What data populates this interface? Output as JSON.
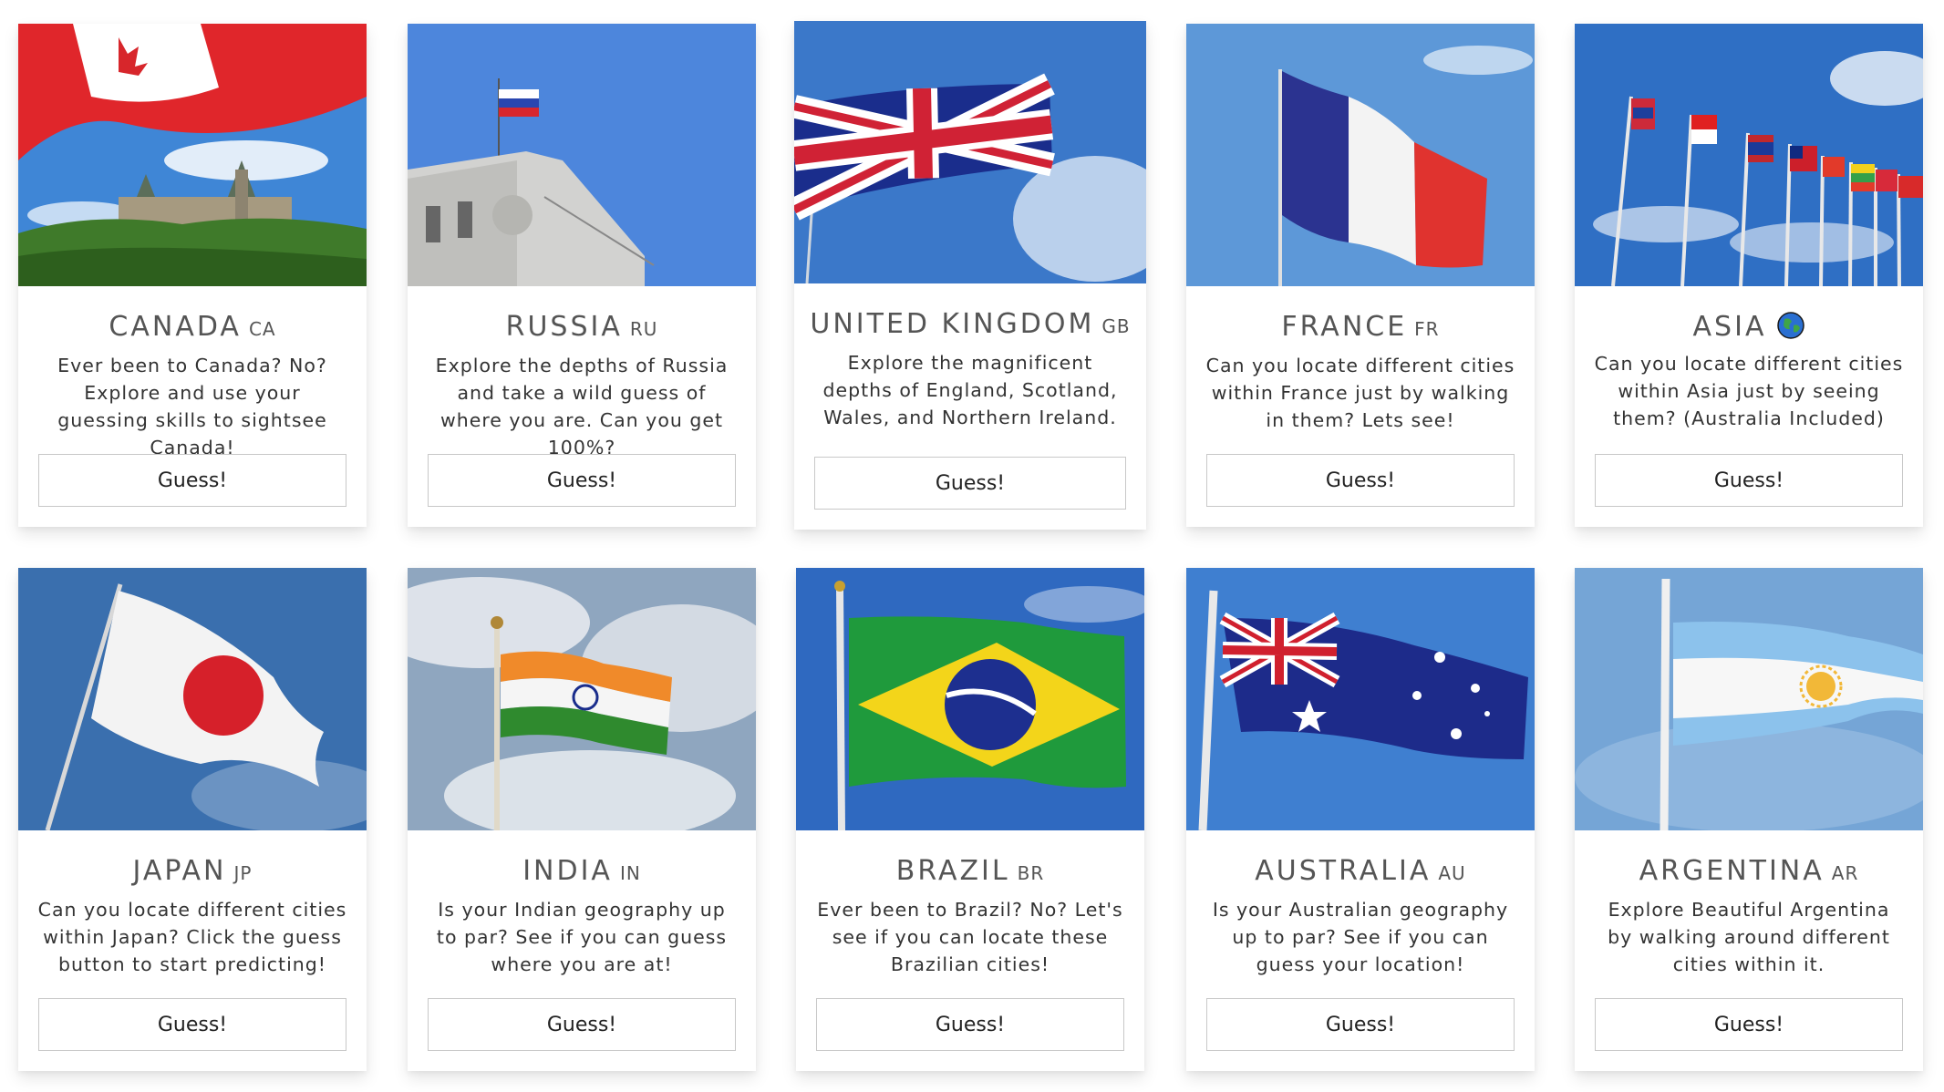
{
  "cards": [
    {
      "name": "CANADA",
      "code": "CA",
      "desc": "Ever been to Canada? No? Explore and use your guessing skills to sightsee Canada!",
      "button": "Guess!"
    },
    {
      "name": "RUSSIA",
      "code": "RU",
      "desc": "Explore the depths of Russia and take a wild guess of where you are. Can you get 100%?",
      "button": "Guess!"
    },
    {
      "name": "UNITED KINGDOM",
      "code": "GB",
      "desc": "Explore the magnificent depths of England, Scotland, Wales, and Northern Ireland.",
      "button": "Guess!"
    },
    {
      "name": "FRANCE",
      "code": "FR",
      "desc": "Can you locate different cities within France just by walking in them? Lets see!",
      "button": "Guess!"
    },
    {
      "name": "ASIA",
      "code": "",
      "desc": "Can you locate different cities within Asia just by seeing them? (Australia Included)",
      "button": "Guess!",
      "icon": "globe-icon"
    },
    {
      "name": "JAPAN",
      "code": "JP",
      "desc": "Can you locate different cities within Japan? Click the guess button to start predicting!",
      "button": "Guess!"
    },
    {
      "name": "INDIA",
      "code": "IN",
      "desc": "Is your Indian geography up to par? See if you can guess where you are at!",
      "button": "Guess!"
    },
    {
      "name": "BRAZIL",
      "code": "BR",
      "desc": "Ever been to Brazil? No? Let's see if you can locate these Brazilian cities!",
      "button": "Guess!"
    },
    {
      "name": "AUSTRALIA",
      "code": "AU",
      "desc": "Is your Australian geography up to par? See if you can guess your location!",
      "button": "Guess!"
    },
    {
      "name": "ARGENTINA",
      "code": "AR",
      "desc": "Explore Beautiful Argentina by walking around different cities within it.",
      "button": "Guess!"
    }
  ],
  "colors": {
    "sky": "#4a86d8",
    "text": "#555555",
    "border": "#c8c8c8"
  }
}
